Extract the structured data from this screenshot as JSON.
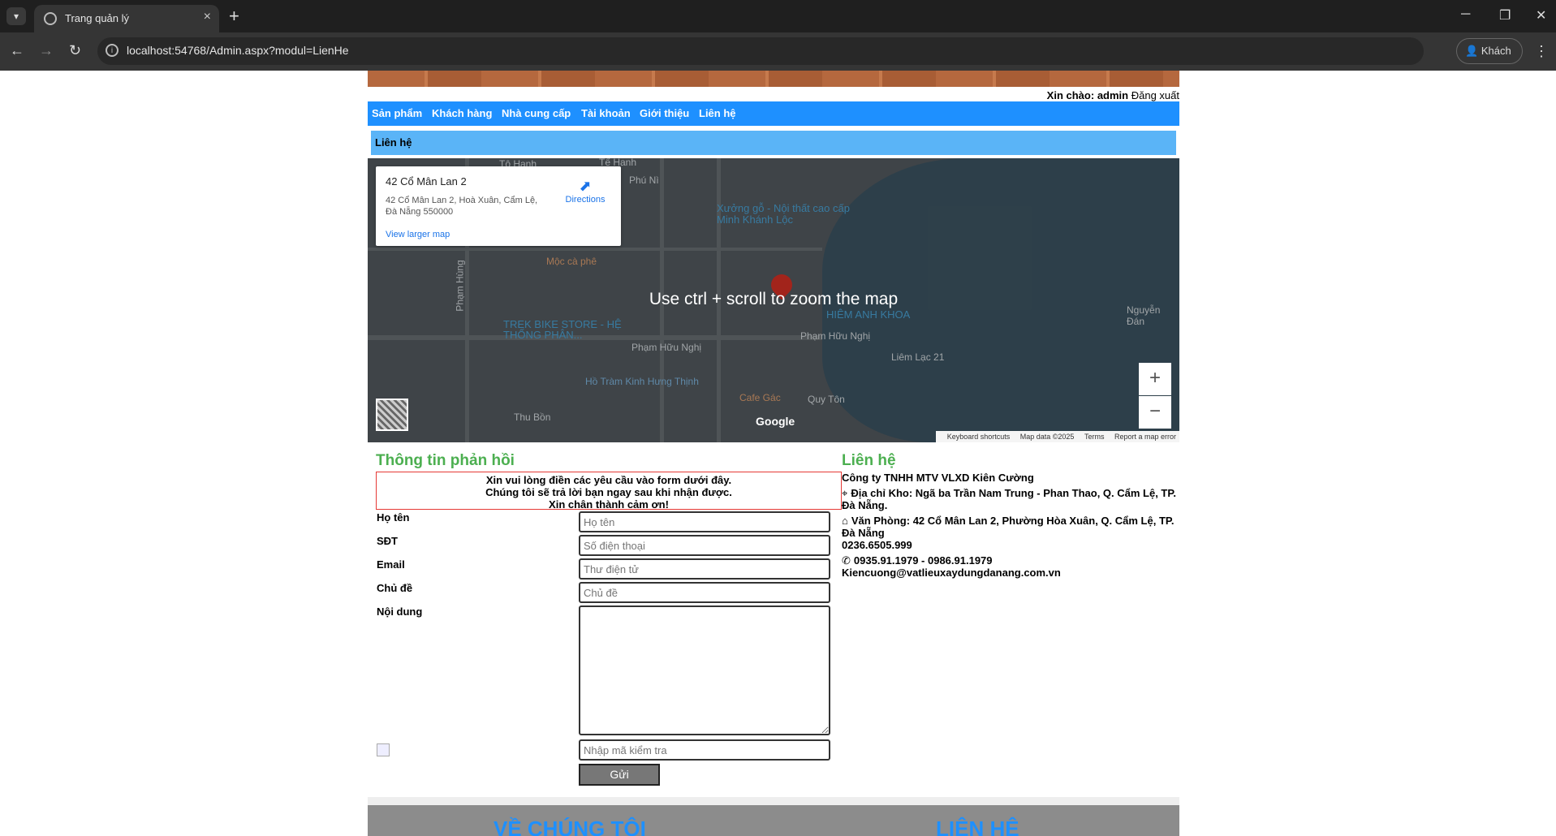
{
  "browser": {
    "tab_title": "Trang quản lý",
    "url": "localhost:54768/Admin.aspx?modul=LienHe",
    "profile_label": "Khách"
  },
  "header": {
    "greeting_prefix": "Xin chào:",
    "username": "admin",
    "logout": "Đăng xuất"
  },
  "menu": [
    "Sản phẩm",
    "Khách hàng",
    "Nhà cung cấp",
    "Tài khoản",
    "Giới thiệu",
    "Liên hệ"
  ],
  "breadcrumb": "Liên hệ",
  "map": {
    "place_name": "42 Cổ Mân Lan 2",
    "place_address": "42 Cổ Mân Lan 2, Hoà Xuân, Cẩm Lệ, Đà Nẵng 550000",
    "directions": "Directions",
    "view_larger": "View larger map",
    "hint": "Use ctrl + scroll to zoom the map",
    "labels": [
      "Tô Hạnh",
      "Tế Hanh",
      "Phú Nì",
      "Mộc cà phê",
      "Phạm Hùng",
      "Phạm Hữu Nghị",
      "Hồ Tràm Kinh Hưng Thịnh",
      "Cafe Gác",
      "Xưởng gỗ - Nội thất cao cấp Minh Khánh Lộc",
      "HIÊM ANH KHOA",
      "Liêm Lạc 21",
      "Thu Bồn",
      "TREK BIKE STORE - HỆ THỐNG PHÂN...",
      "Phạm Hữu Nghị",
      "Quy Tôn",
      "Nguyễn Đán"
    ],
    "footer_items": [
      "Keyboard shortcuts",
      "Map data ©2025",
      "Terms",
      "Report a map error"
    ],
    "google": "Google"
  },
  "feedback": {
    "title": "Thông tin phản hồi",
    "notice_lines": [
      "Xin vui lòng điền các yêu cầu vào form dưới đây.",
      "Chúng tôi sẽ trả lời bạn ngay sau khi nhận được.",
      "Xin chân thành cảm ơn!"
    ],
    "fields": [
      {
        "label": "Họ tên",
        "placeholder": "Họ tên"
      },
      {
        "label": "SĐT",
        "placeholder": "Số điện thoại"
      },
      {
        "label": "Email",
        "placeholder": "Thư điện tử"
      },
      {
        "label": "Chủ đề",
        "placeholder": "Chủ đề"
      }
    ],
    "content_label": "Nội dung",
    "captcha_placeholder": "Nhập mã kiểm tra",
    "submit": "Gửi"
  },
  "contact": {
    "title": "Liên hệ",
    "company": "Công ty TNHH MTV VLXD Kiên Cường",
    "warehouse": "Địa chỉ Kho: Ngã ba Trần Nam Trung - Phan Thao, Q. Cẩm Lệ, TP. Đà Nẵng.",
    "office": "Văn Phòng: 42 Cổ Mân Lan 2, Phường Hòa Xuân, Q. Cẩm Lệ, TP. Đà Nẵng",
    "phone_office": "0236.6505.999",
    "mobiles": "0935.91.1979 - 0986.91.1979",
    "email": "Kiencuong@vatlieuxaydungdanang.com.vn"
  },
  "footer": {
    "left_heading": "VỀ CHÚNG TÔI",
    "right_heading": "LIÊN HỆ"
  }
}
